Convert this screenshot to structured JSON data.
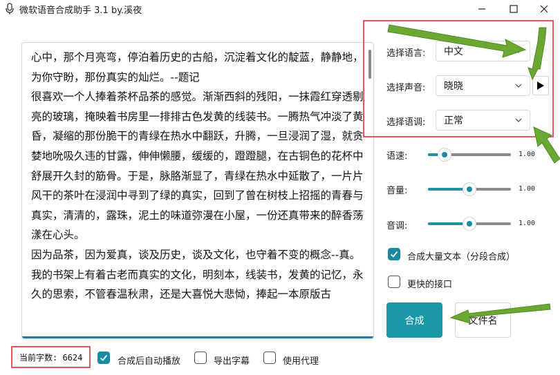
{
  "window": {
    "title": "微软语音合成助手 3.1 by.溪夜"
  },
  "editor": {
    "text": "心中，那个月亮弯，停泊着历史的古船，沉淀着文化的靛蓝，静静地，为你守盼，那份真实的灿烂。--题记\n很喜欢一个人捧着茶杯品茶的感觉。渐渐西斜的残阳，一抹霞红穿透剔亮的玻璃，掩映着书房里一排排古色发黄的线装书。一腾热气冲淡了黄昏，凝缩的那份脆干的青绿在热水中翻跃，升腾，一旦浸润了湿，就贪婪地吮吸久违的甘露，伸伸懒腰，缓缓的，蹬蹬腿，在古铜色的花杯中舒展开久封的筋骨。于是，脉胳渐显了，青绿在热水中延散了，一片片风干的茶叶在浸润中寻到了绿的真实，回到了曾在树枝上招摇的青春与真实，清清的，露珠，泥土的味道弥漫在小屋，一份还真带来的醉香荡漾在心头。\n因为品茶，因为爱真，谈及历史，谈及文化，也守着不变的概念--真。\n我的书架上有着古老而真实的文化，明刻本，线装书，发黄的记忆，永久的思索，不管春温秋肃，还是大喜悦大悲恸，捧起一本原版古"
  },
  "settings": {
    "language_label": "选择语言:",
    "language_value": "中文",
    "voice_label": "选择声音:",
    "voice_value": "晓晓",
    "tone_label": "选择语调:",
    "tone_value": "正常"
  },
  "sliders": [
    {
      "label": "语速:",
      "value": "1.00",
      "level": 0.2
    },
    {
      "label": "音量:",
      "value": "1.00",
      "level": 0.5
    },
    {
      "label": "音调:",
      "value": "1.00",
      "level": 0.5
    }
  ],
  "options": {
    "bulk_label": "合成大量文本（分段合成）",
    "bulk_checked": true,
    "fast_label": "更快的接口",
    "fast_checked": false
  },
  "actions": {
    "synthesize_label": "合成",
    "secondary_label": "文件名"
  },
  "footer": {
    "count_label": "当前字数: 6624",
    "autoplay_label": "合成后自动播放",
    "autoplay_checked": true,
    "export_label": "导出字幕",
    "export_checked": false,
    "proxy_label": "使用代理",
    "proxy_checked": false
  },
  "colors": {
    "accent": "#1a98a8",
    "annotation_box": "#e05a5a",
    "annotation_arrow": "#6aa832"
  },
  "icons": [
    "microphone-icon",
    "minimize-icon",
    "maximize-icon",
    "close-icon",
    "chevron-down-icon",
    "play-icon",
    "check-icon",
    "arrow-annotation"
  ]
}
